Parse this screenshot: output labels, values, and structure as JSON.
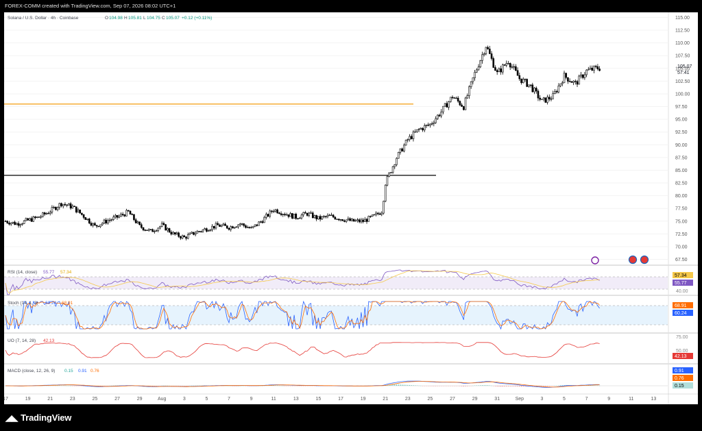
{
  "header": {
    "caption": "FOREX-COMM created with TradingView.com, Sep 07, 2026 08:02 UTC+1"
  },
  "legend": {
    "symbol": "Solana / U.S. Dollar · 4h · Coinbase",
    "open_label": "O",
    "open": "104.98",
    "high_label": "H",
    "high": "105.81",
    "low_label": "L",
    "low": "104.75",
    "close_label": "C",
    "close": "105.07",
    "change": "+0.12 (+0.11%)"
  },
  "price_axis": {
    "ticks": [
      "115.00",
      "112.50",
      "110.00",
      "107.50",
      "105.00",
      "102.50",
      "100.00",
      "97.50",
      "95.00",
      "92.50",
      "90.00",
      "87.50",
      "85.00",
      "82.50",
      "80.00",
      "77.50",
      "75.00",
      "72.50",
      "70.00",
      "67.50"
    ],
    "last_price": "105.07",
    "countdown": "57:41"
  },
  "levels": [
    {
      "name": "resistance",
      "price": 98.0,
      "color": "#f5a623"
    },
    {
      "name": "support",
      "price": 84.0,
      "color": "#000000"
    }
  ],
  "panes": {
    "rsi": {
      "label": "RSI (14, close)",
      "value": "55.77",
      "ma": "57.34",
      "axis_tick": "40.00",
      "color": "#7e57c2",
      "ma_color": "#f5c84a"
    },
    "stoch": {
      "label": "Stoch (14, 1, 3)",
      "k": "60.24",
      "d": "68.91",
      "k_color": "#2962ff",
      "d_color": "#ff6d00"
    },
    "uo": {
      "label": "UO (7, 14, 28)",
      "value": "42.13",
      "axis_top": "75.00",
      "axis_mid": "50.00",
      "color": "#e53935"
    },
    "macd": {
      "label": "MACD (close, 12, 26, 9)",
      "hist": "0.15",
      "macd": "0.91",
      "signal": "0.76",
      "macd_color": "#2962ff",
      "signal_color": "#ff6d00",
      "hist_color": "#26a69a"
    }
  },
  "time_axis": {
    "labels": [
      "17",
      "19",
      "21",
      "23",
      "25",
      "27",
      "29",
      "Aug",
      "3",
      "5",
      "7",
      "9",
      "11",
      "13",
      "15",
      "17",
      "19",
      "21",
      "23",
      "25",
      "27",
      "29",
      "31",
      "Sep",
      "3",
      "5",
      "7",
      "9",
      "11",
      "13"
    ]
  },
  "footer": {
    "brand": "TradingView",
    "logo_glyph": "tv-logo-icon"
  },
  "chart_data": {
    "type": "candlestick",
    "title": "Solana / U.S. Dollar · 4h · Coinbase",
    "ylim": [
      66.5,
      116.0
    ],
    "x_start": "Jul 16",
    "x_end": "Sep 07",
    "anchors": [
      [
        "Jul 16",
        75.0
      ],
      [
        "Jul 17",
        74.5
      ],
      [
        "Jul 19",
        75.8
      ],
      [
        "Jul 20",
        77.0
      ],
      [
        "Jul 21",
        78.5
      ],
      [
        "Jul 22",
        77.8
      ],
      [
        "Jul 23",
        76.0
      ],
      [
        "Jul 24",
        74.0
      ],
      [
        "Jul 25",
        75.0
      ],
      [
        "Jul 26",
        75.8
      ],
      [
        "Jul 27",
        76.8
      ],
      [
        "Jul 28",
        74.0
      ],
      [
        "Jul 29",
        73.0
      ],
      [
        "Jul 30",
        74.2
      ],
      [
        "Jul 31",
        72.5
      ],
      [
        "Aug 1",
        71.8
      ],
      [
        "Aug 2",
        72.8
      ],
      [
        "Aug 3",
        73.5
      ],
      [
        "Aug 4",
        74.2
      ],
      [
        "Aug 5",
        73.8
      ],
      [
        "Aug 6",
        74.5
      ],
      [
        "Aug 7",
        73.5
      ],
      [
        "Aug 8",
        75.2
      ],
      [
        "Aug 9",
        77.3
      ],
      [
        "Aug 10",
        76.5
      ],
      [
        "Aug 11",
        75.8
      ],
      [
        "Aug 12",
        76.5
      ],
      [
        "Aug 13",
        75.5
      ],
      [
        "Aug 14",
        76.0
      ],
      [
        "Aug 15",
        75.5
      ],
      [
        "Aug 16",
        75.0
      ],
      [
        "Aug 17",
        75.0
      ],
      [
        "Aug 18",
        76.0
      ],
      [
        "Aug 18.7",
        77.0
      ],
      [
        "Aug 19",
        82.5
      ],
      [
        "Aug 20",
        87.5
      ],
      [
        "Aug 21",
        91.0
      ],
      [
        "Aug 22",
        93.0
      ],
      [
        "Aug 23",
        94.0
      ],
      [
        "Aug 24",
        96.5
      ],
      [
        "Aug 25",
        99.5
      ],
      [
        "Aug 26",
        97.5
      ],
      [
        "Aug 27",
        104.0
      ],
      [
        "Aug 28",
        109.5
      ],
      [
        "Aug 29",
        104.0
      ],
      [
        "Aug 30",
        106.5
      ],
      [
        "Aug 31",
        103.0
      ],
      [
        "Sep 1",
        101.5
      ],
      [
        "Sep 2",
        98.5
      ],
      [
        "Sep 3",
        99.5
      ],
      [
        "Sep 4",
        103.5
      ],
      [
        "Sep 5",
        102.0
      ],
      [
        "Sep 6",
        104.5
      ],
      [
        "Sep 7",
        105.07
      ]
    ]
  }
}
